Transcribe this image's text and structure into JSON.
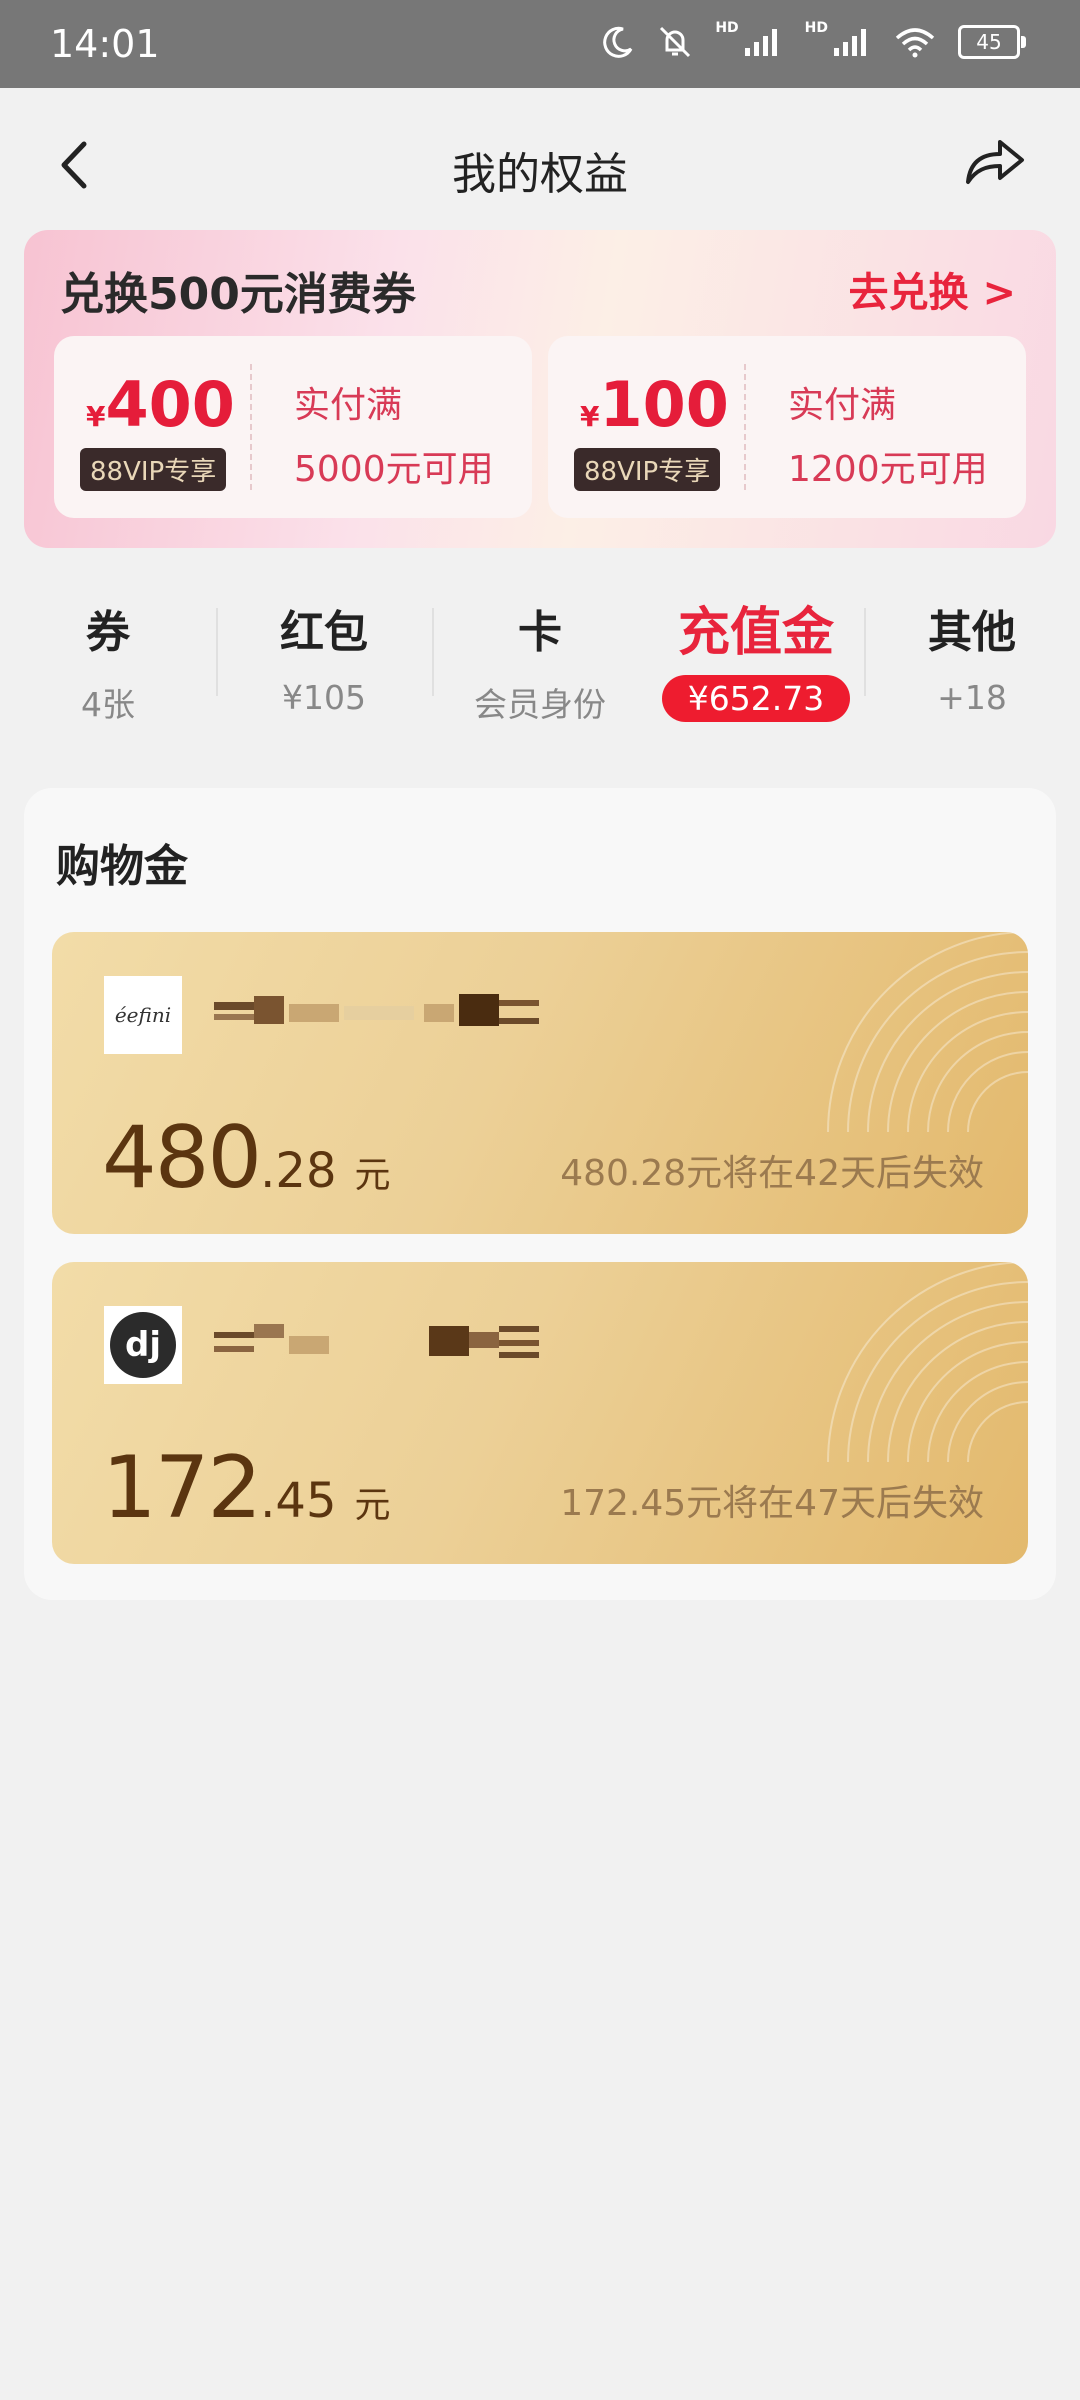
{
  "status": {
    "time": "14:01",
    "battery": "45",
    "hd1": "HD",
    "hd2": "HD"
  },
  "header": {
    "title": "我的权益"
  },
  "promo": {
    "title": "兑换500元消费券",
    "link": "去兑换 >",
    "coupons": [
      {
        "yen": "¥",
        "amount": "400",
        "badge": "88VIP专享",
        "cond1": "实付满",
        "cond2": "5000元可用"
      },
      {
        "yen": "¥",
        "amount": "100",
        "badge": "88VIP专享",
        "cond1": "实付满",
        "cond2": "1200元可用"
      }
    ]
  },
  "tabs": [
    {
      "label": "券",
      "sub": "4张"
    },
    {
      "label": "红包",
      "sub": "¥105"
    },
    {
      "label": "卡",
      "sub": "会员身份"
    },
    {
      "label": "充值金",
      "sub": "¥652.73",
      "active": true
    },
    {
      "label": "其他",
      "sub": "+18"
    }
  ],
  "shopping": {
    "title": "购物金",
    "cards": [
      {
        "logo_text": "éefini",
        "integer": "480",
        "decimal": ".28",
        "unit": "元",
        "expire": "480.28元将在42天后失效"
      },
      {
        "logo_text": "dj",
        "integer": "172",
        "decimal": ".45",
        "unit": "元",
        "expire": "172.45元将在47天后失效"
      }
    ]
  },
  "colors": {
    "accent": "#e8243c",
    "gold_text": "#5b3510",
    "status_bar": "#777777"
  }
}
